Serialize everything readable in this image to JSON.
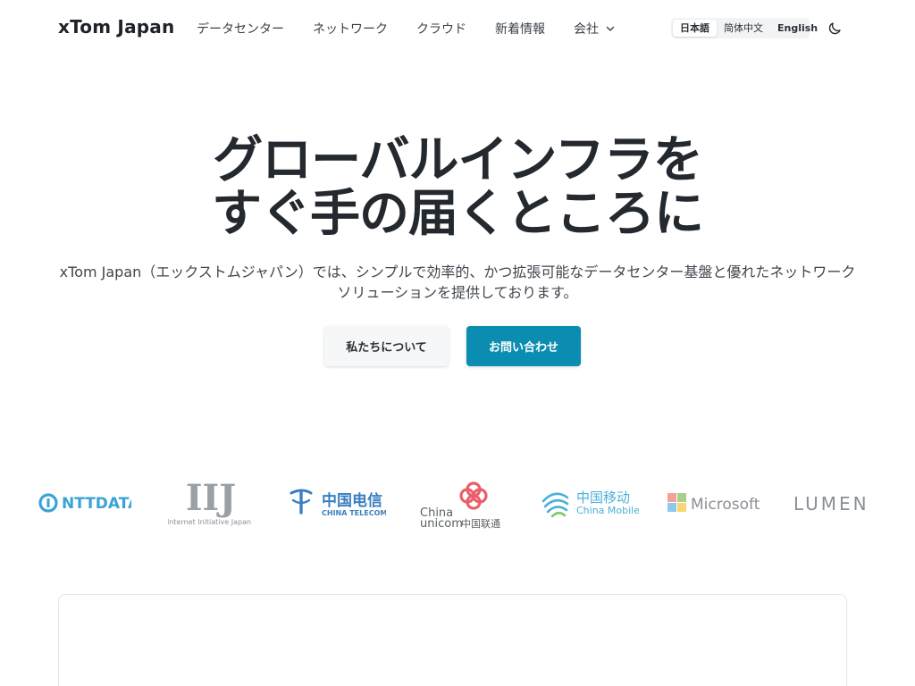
{
  "header": {
    "brand": "xTom Japan",
    "nav": [
      {
        "label": "データセンター"
      },
      {
        "label": "ネットワーク"
      },
      {
        "label": "クラウド"
      },
      {
        "label": "新着情報"
      },
      {
        "label": "会社"
      }
    ],
    "languages": [
      {
        "label": "日本語",
        "active": true
      },
      {
        "label": "简体中文",
        "active": false
      },
      {
        "label": "English",
        "active": false
      }
    ],
    "theme_icon": "moon-icon"
  },
  "hero": {
    "title_line1": "グローバルインフラを",
    "title_line2": "すぐ手の届くところに",
    "description": "xTom Japan（エックストムジャパン）では、シンプルで効率的、かつ拡張可能なデータセンター基盤と優れたネットワークソリューションを提供しております。",
    "btn_about": "私たちについて",
    "btn_contact": "お問い合わせ"
  },
  "partners": {
    "ntt": "NTTDATA",
    "iij_mark": "IIJ",
    "iij_caption": "Internet Initiative Japan",
    "telecom_cn": "中国电信",
    "telecom_en": "CHINA TELECOM",
    "unicom_en1": "China",
    "unicom_en2": "unicom",
    "unicom_cn": "中国联通",
    "mobile_cn": "中国移动",
    "mobile_en": "China Mobile",
    "microsoft": "Microsoft",
    "lumen": "LUMEN"
  },
  "colors": {
    "accent": "#0b8db2",
    "ntt_blue": "#3aa3d6",
    "unicom_red": "#e8606b",
    "mobile_blue": "#4ab0d8"
  }
}
